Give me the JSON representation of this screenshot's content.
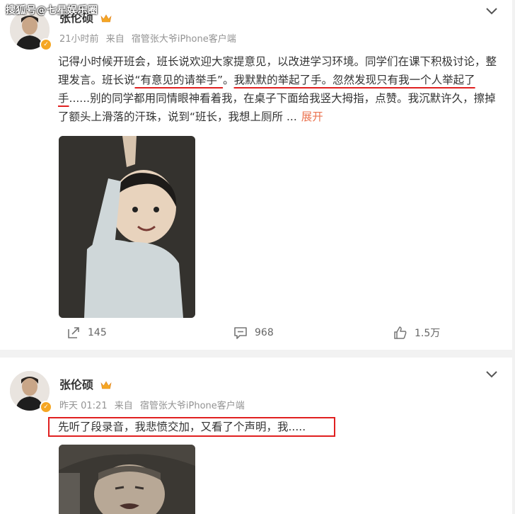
{
  "watermark": "搜狐号@七星娱乐圈",
  "posts": [
    {
      "author": "张伦硕",
      "time": "21小时前",
      "source_prefix": "来自",
      "source": "宿管张大爷iPhone客户端",
      "text_parts": [
        "记得小时候开班会，班长说欢迎大家提意见，以改进学习环境。同学们在课下积极讨论，整理发言。班长说",
        "“有意见的请举手”",
        "。",
        "我默默的举起了手。忽然发现只有我一个人举起了手",
        "......别的同学都用同情眼神看着我，在桌子下面给我竖大拇指，点赞。我沉默许久，擦掉了额头上滑落的汗珠，说到“班长，我想上厕所 ..."
      ],
      "expand_label": "展开",
      "reposts": "145",
      "comments": "968",
      "likes": "1.5万"
    },
    {
      "author": "张伦硕",
      "time": "昨天 01:21",
      "source_prefix": "来自",
      "source": "宿管张大爷iPhone客户端",
      "text": "先听了段录音，我悲愤交加，又看了个声明，我....."
    }
  ],
  "icons": {
    "repost": "repost-icon",
    "comment": "comment-icon",
    "like": "thumbs-up-icon",
    "menu": "chevron-down-icon",
    "verified": "verified-badge-icon",
    "crown": "crown-icon"
  },
  "colors": {
    "accent": "#eb7350",
    "highlight": "#e02020",
    "badge": "#f5a623",
    "meta": "#939393"
  }
}
